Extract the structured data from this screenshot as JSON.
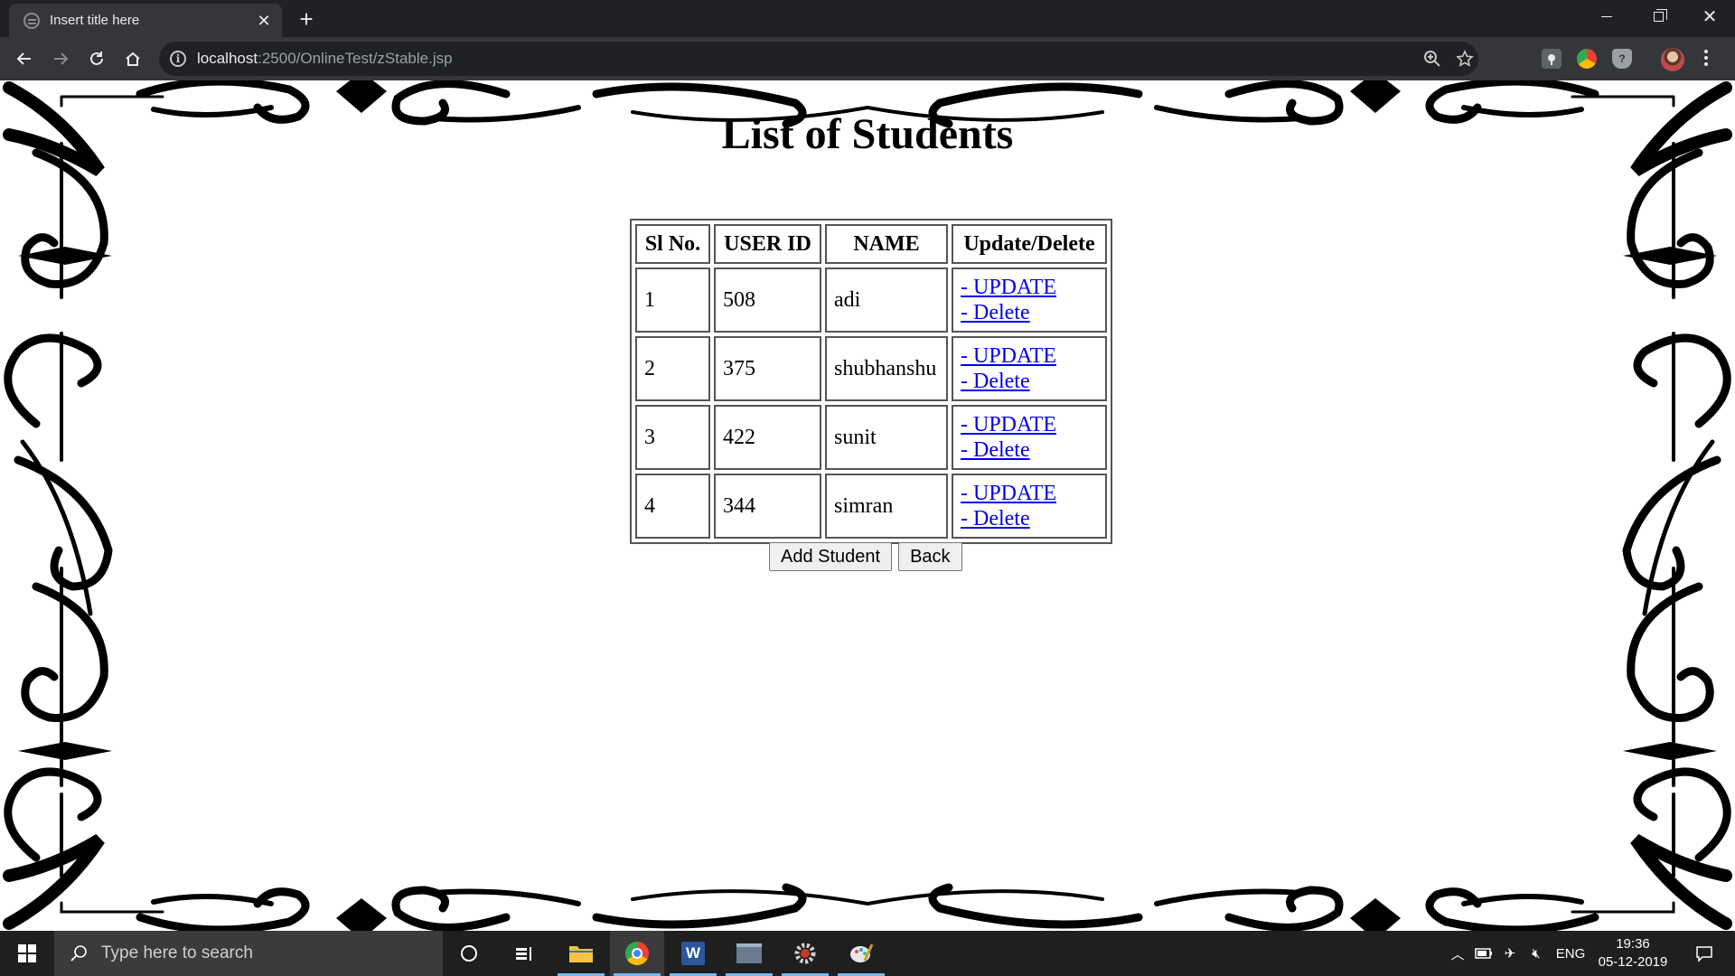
{
  "browser": {
    "tab_title": "Insert title here",
    "url_host": "localhost",
    "url_rest": ":2500/OnlineTest/zStable.jsp"
  },
  "page": {
    "title": "List of Students",
    "table": {
      "headers": [
        "Sl No.",
        "USER ID",
        "NAME",
        "Update/Delete"
      ],
      "rows": [
        {
          "sl": "1",
          "user_id": "508",
          "name": "adi"
        },
        {
          "sl": "2",
          "user_id": "375",
          "name": "shubhanshu"
        },
        {
          "sl": "3",
          "user_id": "422",
          "name": "sunit"
        },
        {
          "sl": "4",
          "user_id": "344",
          "name": "simran"
        }
      ],
      "update_label": "- UPDATE",
      "delete_label": "- Delete"
    },
    "buttons": {
      "add_student": "Add Student",
      "back": "Back"
    }
  },
  "taskbar": {
    "search_placeholder": "Type here to search",
    "language": "ENG",
    "time": "19:36",
    "date": "05-12-2019"
  },
  "colors": {
    "link": "#0000ee",
    "chrome_dark": "#202124",
    "chrome_toolbar": "#35363a",
    "taskbar": "#1f1f1f",
    "taskbar_active": "#76b9ed"
  }
}
